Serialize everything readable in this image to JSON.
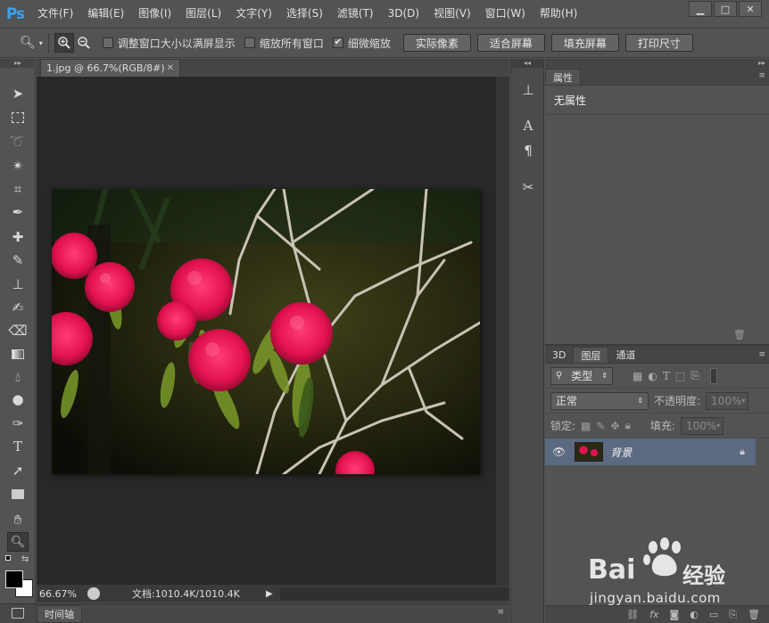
{
  "menubar": {
    "logo": "Ps",
    "items": [
      "文件(F)",
      "编辑(E)",
      "图像(I)",
      "图层(L)",
      "文字(Y)",
      "选择(S)",
      "滤镜(T)",
      "3D(D)",
      "视图(V)",
      "窗口(W)",
      "帮助(H)"
    ]
  },
  "options": {
    "resize_windows_label": "调整窗口大小以满屏显示",
    "zoom_all_label": "缩放所有窗口",
    "scrubby_label": "细微缩放",
    "actual_pixels": "实际像素",
    "fit_screen": "适合屏幕",
    "fill_screen": "填充屏幕",
    "print_size": "打印尺寸",
    "scrubby_checked": true
  },
  "document": {
    "tab_title": "1.jpg @ 66.7%(RGB/8#)",
    "zoom": "66.67%",
    "doc_info": "文档:1010.4K/1010.4K"
  },
  "timeline": {
    "tab_label": "时间轴"
  },
  "properties": {
    "tab_label": "属性",
    "body_text": "无属性"
  },
  "layers": {
    "tabs": [
      "3D",
      "图层",
      "通道"
    ],
    "filter_kind": "类型",
    "blend_mode": "正常",
    "opacity_label": "不透明度:",
    "opacity_value": "100%",
    "lock_label": "锁定:",
    "fill_label": "填充:",
    "fill_value": "100%",
    "layer_name": "背景"
  },
  "watermark": {
    "brand": "Bai",
    "brand2": "经验",
    "url": "jingyan.baidu.com"
  },
  "colors": {
    "ps_blue": "#38a2f0",
    "selected_layer": "#5b6a80",
    "canvas_bg": "#282828",
    "flower": "#e0134e"
  }
}
